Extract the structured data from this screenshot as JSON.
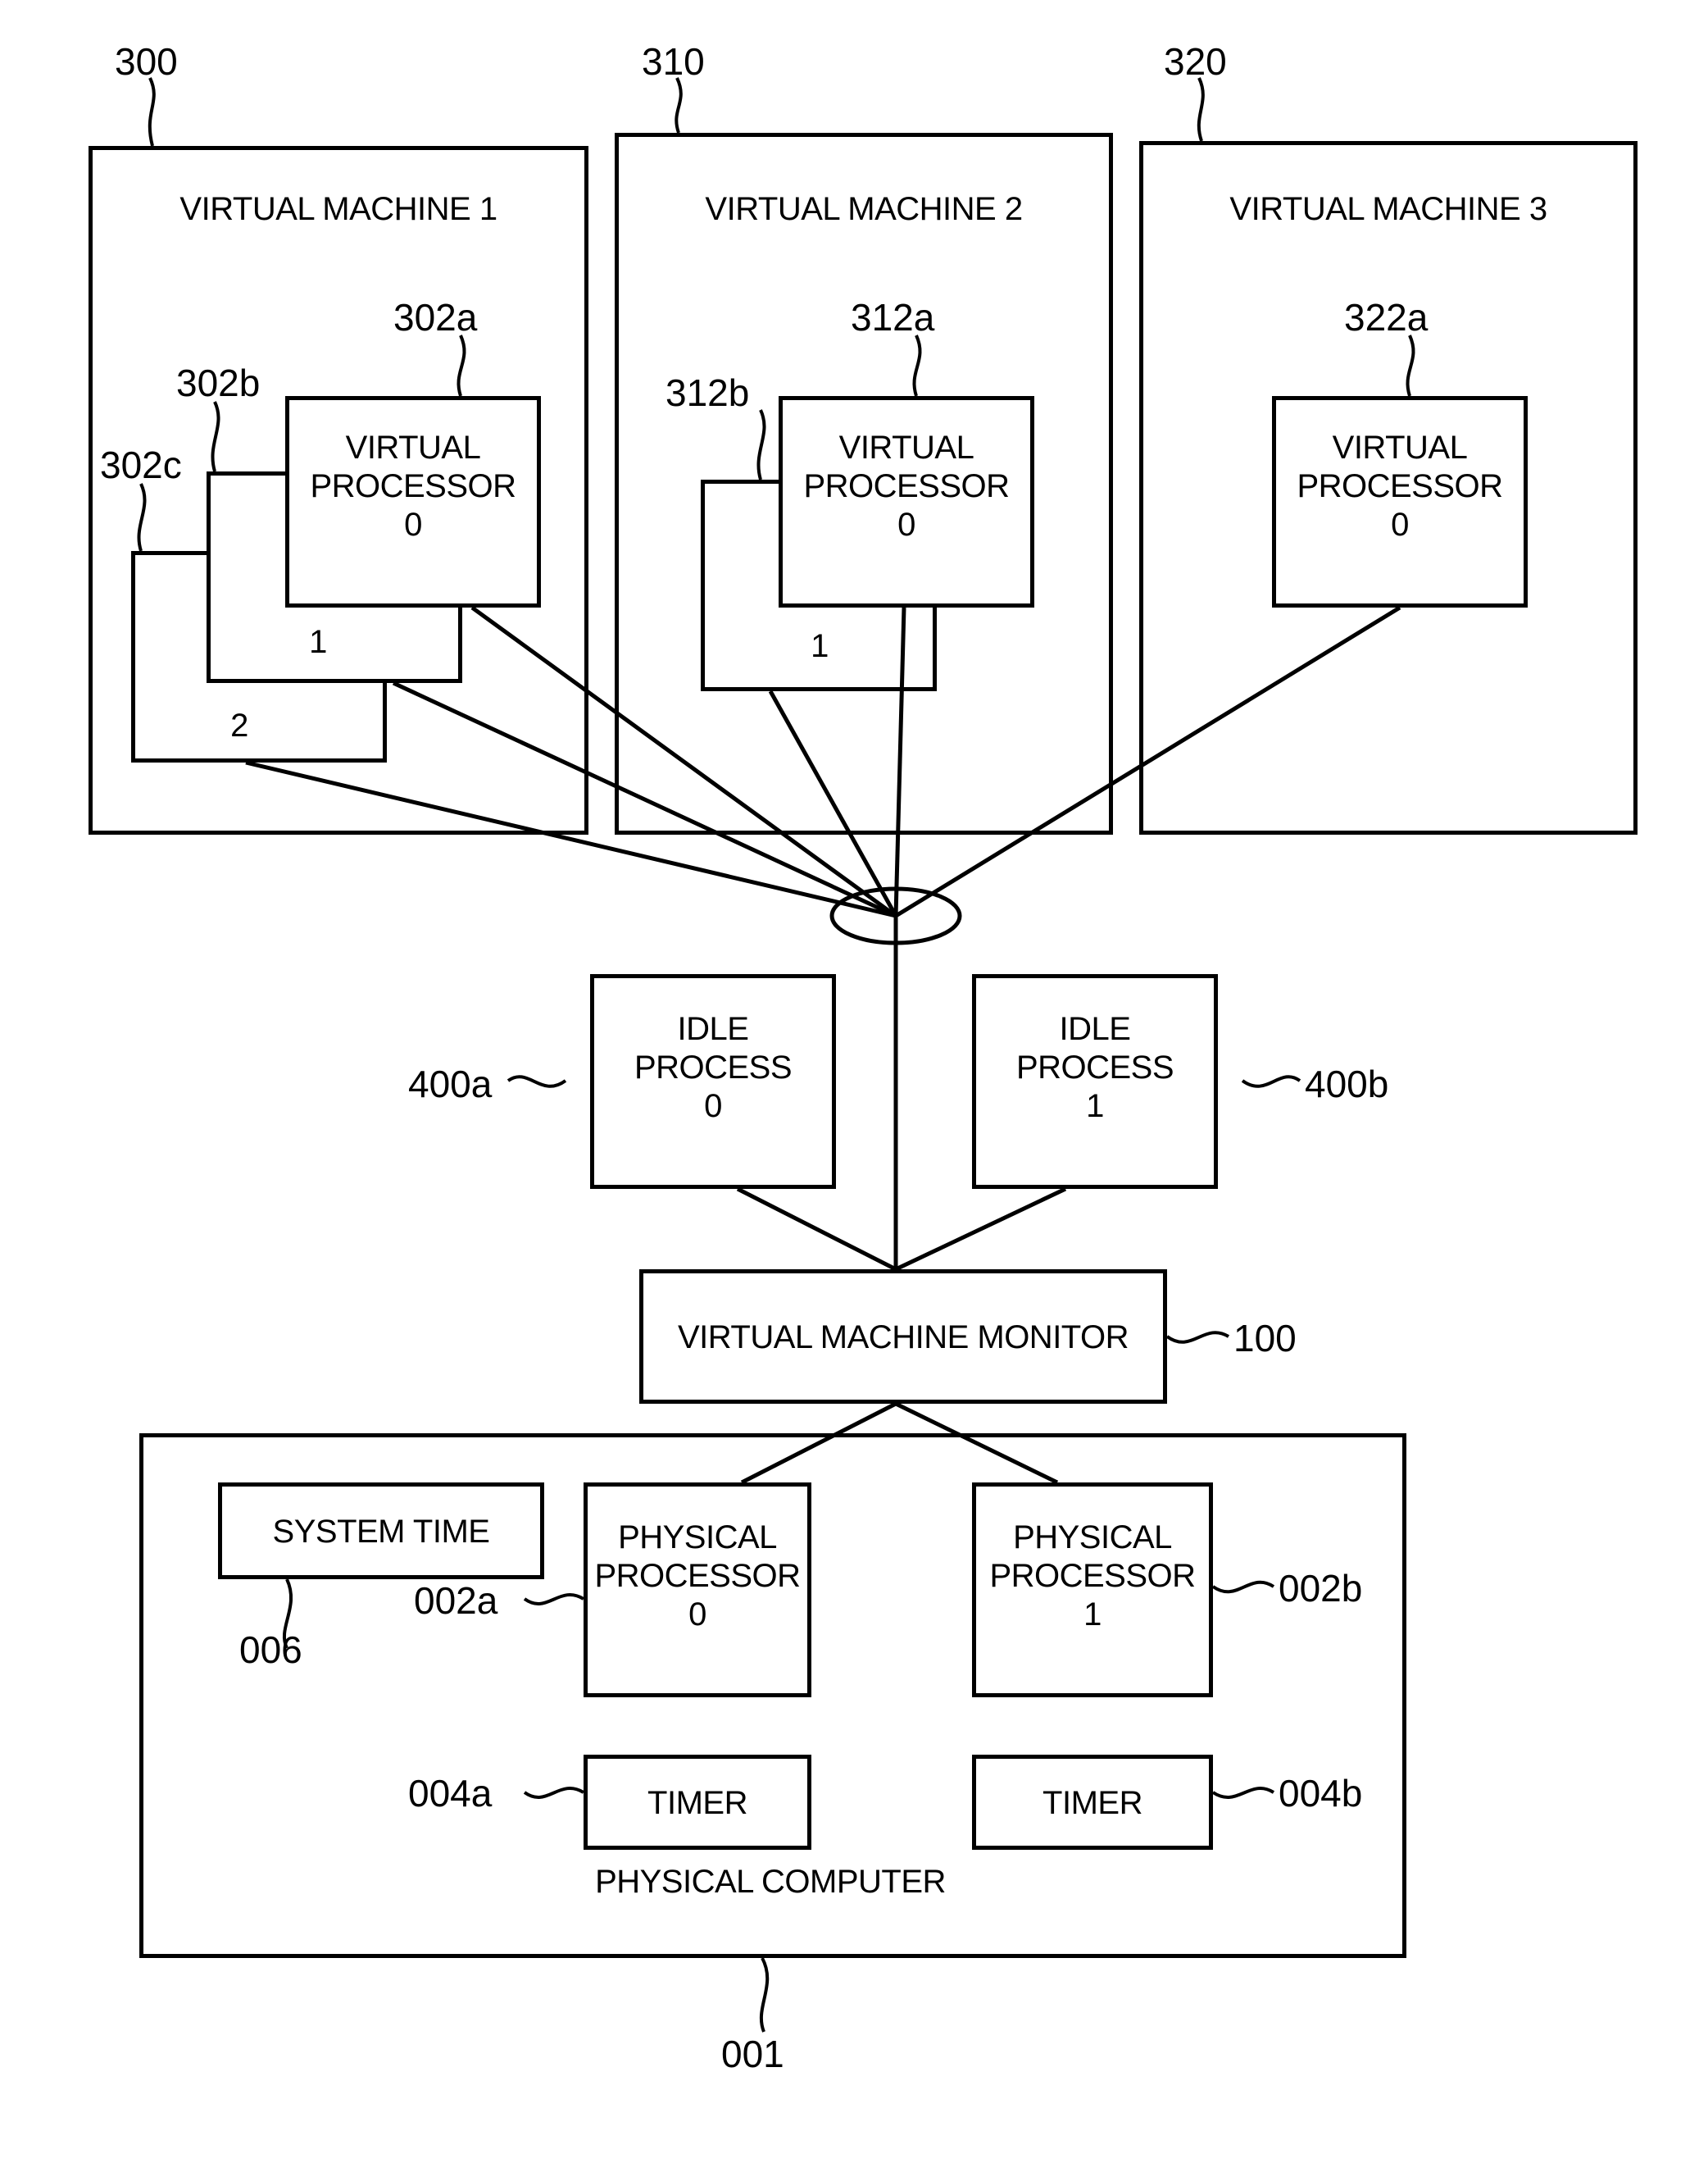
{
  "figure": {
    "type": "patent-block-diagram",
    "background_color": "#ffffff",
    "line_color": "#000000"
  },
  "virtual_machines": [
    {
      "ref": "300",
      "title": "VIRTUAL MACHINE 1",
      "processors": [
        {
          "ref": "302a",
          "label": "VIRTUAL\nPROCESSOR\n0",
          "index": "0"
        },
        {
          "ref": "302b",
          "label": "1",
          "index": "1"
        },
        {
          "ref": "302c",
          "label": "2",
          "index": "2"
        }
      ]
    },
    {
      "ref": "310",
      "title": "VIRTUAL MACHINE 2",
      "processors": [
        {
          "ref": "312a",
          "label": "VIRTUAL\nPROCESSOR\n0",
          "index": "0"
        },
        {
          "ref": "312b",
          "label": "1",
          "index": "1"
        }
      ]
    },
    {
      "ref": "320",
      "title": "VIRTUAL MACHINE 3",
      "processors": [
        {
          "ref": "322a",
          "label": "VIRTUAL\nPROCESSOR\n0",
          "index": "0"
        }
      ]
    }
  ],
  "idle_processes": [
    {
      "ref": "400a",
      "label": "IDLE\nPROCESS\n0",
      "index": "0"
    },
    {
      "ref": "400b",
      "label": "IDLE\nPROCESS\n1",
      "index": "1"
    }
  ],
  "monitor": {
    "ref": "100",
    "label": "VIRTUAL MACHINE MONITOR"
  },
  "physical_computer": {
    "ref": "001",
    "label": "PHYSICAL COMPUTER",
    "system_time": {
      "ref": "006",
      "label": "SYSTEM TIME"
    },
    "processors": [
      {
        "ref": "002a",
        "label": "PHYSICAL\nPROCESSOR\n0",
        "index": "0"
      },
      {
        "ref": "002b",
        "label": "PHYSICAL\nPROCESSOR\n1",
        "index": "1"
      }
    ],
    "timers": [
      {
        "ref": "004a",
        "label": "TIMER"
      },
      {
        "ref": "004b",
        "label": "TIMER"
      }
    ]
  }
}
